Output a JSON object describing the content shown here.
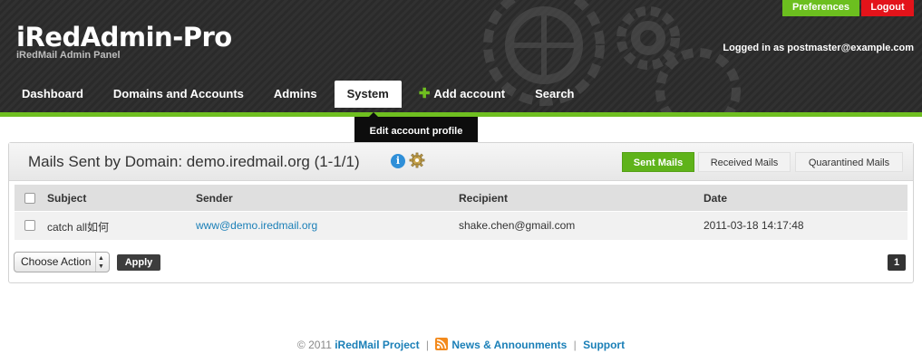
{
  "header": {
    "title": "iRedAdmin-Pro",
    "subtitle": "iRedMail Admin Panel",
    "preferences_label": "Preferences",
    "logout_label": "Logout",
    "logged_in_text": "Logged in as postmaster@example.com",
    "nav": [
      {
        "label": "Dashboard"
      },
      {
        "label": "Domains and Accounts"
      },
      {
        "label": "Admins"
      },
      {
        "label": "System"
      },
      {
        "label": "Add account"
      },
      {
        "label": "Search"
      }
    ],
    "active_nav": "System",
    "tooltip": "Edit account profile"
  },
  "main": {
    "title": "Mails Sent by Domain: demo.iredmail.org (1-1/1)",
    "tabs": [
      {
        "label": "Sent Mails",
        "active": true
      },
      {
        "label": "Received Mails",
        "active": false
      },
      {
        "label": "Quarantined Mails",
        "active": false
      }
    ],
    "table": {
      "columns": [
        "Subject",
        "Sender",
        "Recipient",
        "Date"
      ],
      "rows": [
        {
          "subject": "catch all如何",
          "sender": "www@demo.iredmail.org",
          "recipient": "shake.chen@gmail.com",
          "date": "2011-03-18 14:17:48"
        }
      ]
    },
    "action_select": "Choose Action",
    "apply_label": "Apply",
    "page": "1"
  },
  "footer": {
    "copyright": "© 2011",
    "project_link": "iRedMail Project",
    "news_link": "News & Announments",
    "support_link": "Support",
    "separator": "|"
  },
  "colors": {
    "accent_green": "#6fbf20",
    "logout_red": "#e3131a",
    "link_blue": "#1a7fb7",
    "header_dark": "#2c2c2c"
  },
  "icons": [
    "info-icon",
    "gear-icon",
    "plus-icon",
    "rss-icon",
    "select-arrows-icon"
  ]
}
